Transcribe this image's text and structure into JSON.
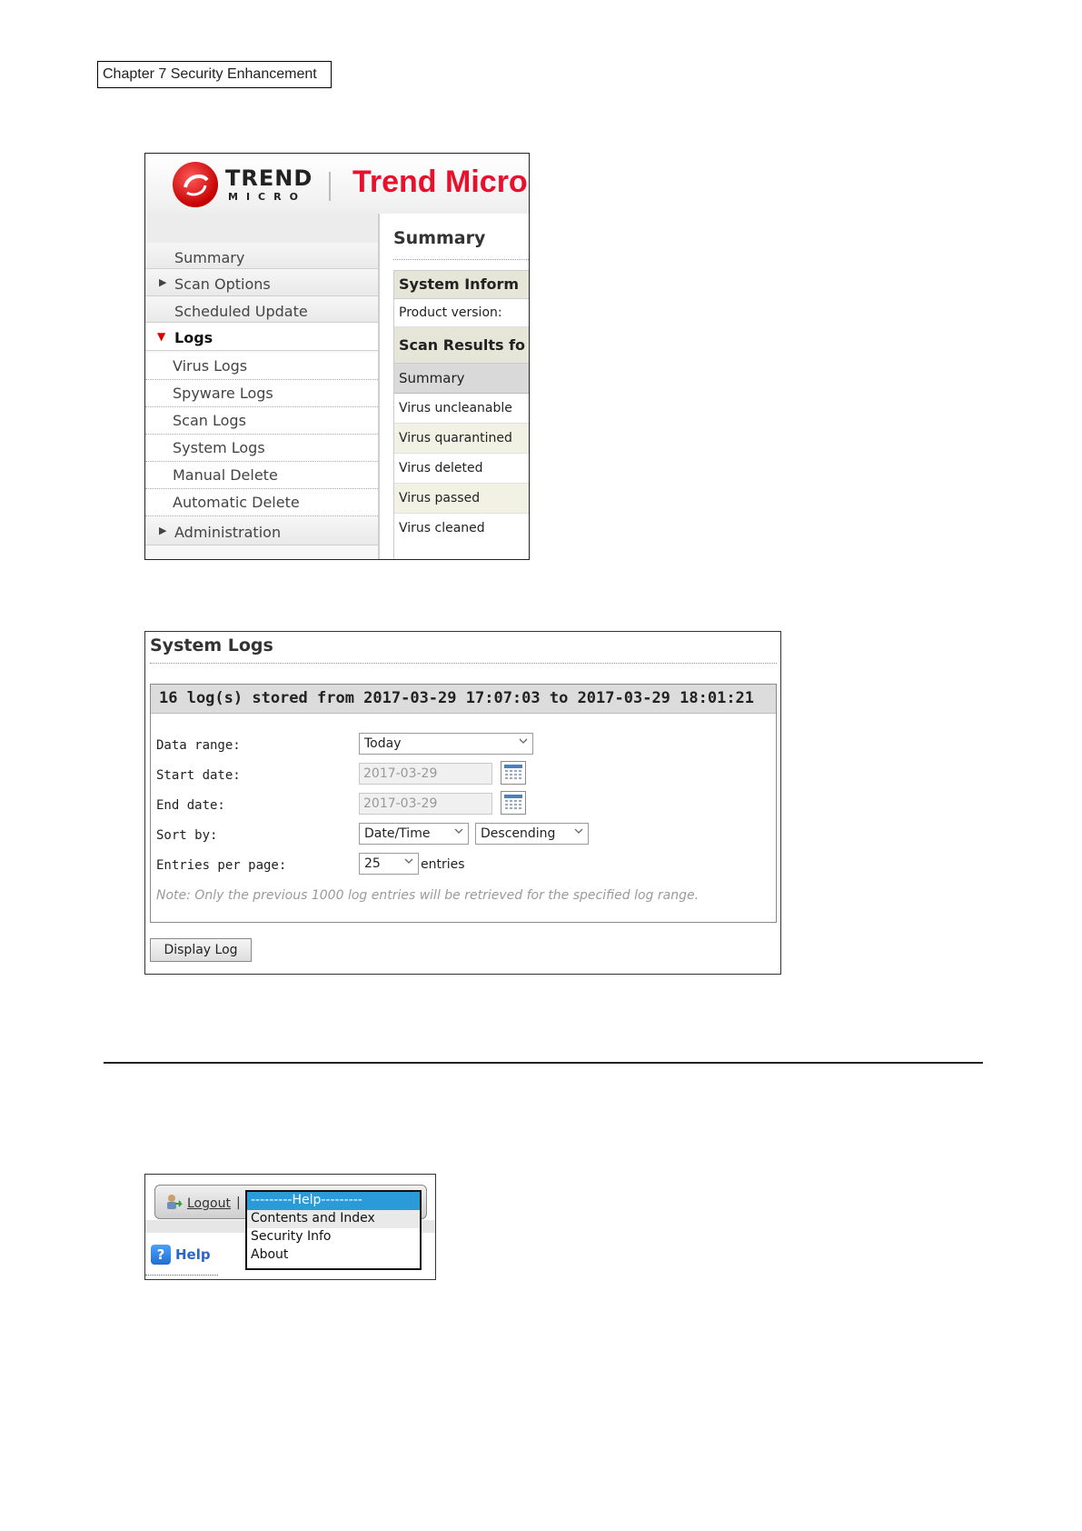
{
  "chapter_header": "Chapter 7 Security Enhancement",
  "trend_app": {
    "logo_word_1": "TREND",
    "logo_word_2": "MICRO",
    "logo_tm": "™",
    "brand_title": "Trend Micro",
    "nav_items": [
      {
        "label": "Summary"
      },
      {
        "label": "Scan Options"
      },
      {
        "label": "Scheduled Update"
      },
      {
        "label": "Logs"
      }
    ],
    "log_sub_items": [
      {
        "label": "Virus Logs"
      },
      {
        "label": "Spyware Logs"
      },
      {
        "label": "Scan Logs"
      },
      {
        "label": "System Logs"
      },
      {
        "label": "Manual Delete"
      },
      {
        "label": "Automatic Delete"
      }
    ],
    "nav_administration": "Administration",
    "summary_title": "Summary",
    "summary_rows": [
      {
        "label": "System Inform"
      },
      {
        "label": "Product version:"
      },
      {
        "label": "Scan Results fo"
      },
      {
        "label": "Summary"
      },
      {
        "label": "Virus uncleanable"
      },
      {
        "label": "Virus quarantined"
      },
      {
        "label": "Virus deleted"
      },
      {
        "label": "Virus passed"
      },
      {
        "label": "Virus cleaned"
      }
    ]
  },
  "system_logs": {
    "title": "System Logs",
    "stored_header": "16 log(s) stored from 2017-03-29 17:07:03 to 2017-03-29 18:01:21",
    "data_range_label": "Data range:",
    "data_range_value": "Today",
    "start_date_label": "Start date:",
    "start_date_value": "2017-03-29",
    "end_date_label": "End date:",
    "end_date_value": "2017-03-29",
    "sort_by_label": "Sort by:",
    "sort_field_value": "Date/Time",
    "sort_order_value": "Descending",
    "entries_label": "Entries per page:",
    "entries_value": "25",
    "entries_suffix": "entries",
    "note": "Note: Only the previous 1000 log entries will be retrieved for the specified log range.",
    "display_button": "Display Log"
  },
  "help_menu": {
    "logout_label": "Logout",
    "pipe": "|",
    "help_label": "Help",
    "help_icon_glyph": "?",
    "menu_items": [
      {
        "label": "---------Help---------"
      },
      {
        "label": "Contents and Index"
      },
      {
        "label": "Security Info"
      },
      {
        "label": "About"
      }
    ]
  },
  "colors": {
    "brand_red": "#e8112d",
    "menu_highlight": "#2a9bd8",
    "help_blue": "#2a66c9"
  }
}
